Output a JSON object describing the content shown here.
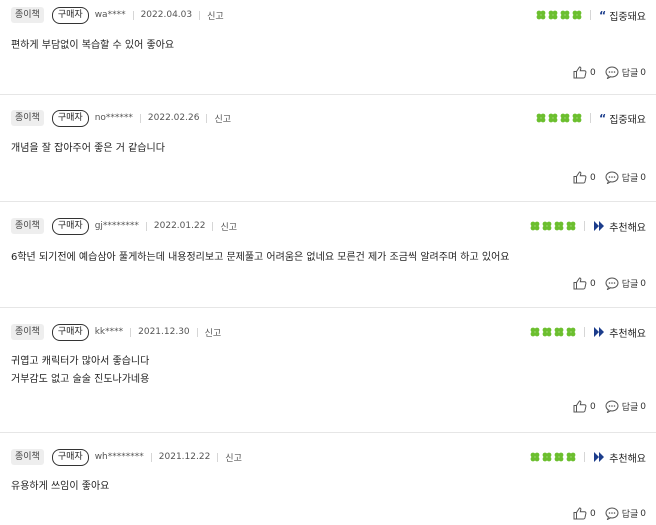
{
  "colors": {
    "star": "#6cbf2f",
    "accent": "#1c3d8c"
  },
  "reviews": [
    {
      "type": "종이책",
      "buyer": "구매자",
      "user": "wa****",
      "date": "2022.04.03",
      "report": "신고",
      "rating_text": "집중돼요",
      "rating_icon": "quote-icon",
      "stars": 4,
      "lines": [
        "편하게 부담없이 복습할 수 있어 좋아요"
      ],
      "likes": "0",
      "reply_label": "답글",
      "replies": "0"
    },
    {
      "type": "종이책",
      "buyer": "구매자",
      "user": "no******",
      "date": "2022.02.26",
      "report": "신고",
      "rating_text": "집중돼요",
      "rating_icon": "quote-icon",
      "stars": 4,
      "lines": [
        "개념을 잘 잡아주어 좋은 거 같습니다"
      ],
      "likes": "0",
      "reply_label": "답글",
      "replies": "0"
    },
    {
      "type": "종이책",
      "buyer": "구매자",
      "user": "gj********",
      "date": "2022.01.22",
      "report": "신고",
      "rating_text": "추천해요",
      "rating_icon": "thumb-icon",
      "stars": 4,
      "lines": [
        "6학년 되기전에 예습삼아 풀게하는데 내용정리보고 문제풀고 어려움은 없네요 모른건 제가 조금씩 알려주며 하고 있어요"
      ],
      "likes": "0",
      "reply_label": "답글",
      "replies": "0"
    },
    {
      "type": "종이책",
      "buyer": "구매자",
      "user": "kk****",
      "date": "2021.12.30",
      "report": "신고",
      "rating_text": "추천해요",
      "rating_icon": "thumb-icon",
      "stars": 4,
      "lines": [
        "귀엽고 캐릭터가 많아서 좋습니다",
        "거부감도 없고 술술 진도나가네용"
      ],
      "likes": "0",
      "reply_label": "답글",
      "replies": "0"
    },
    {
      "type": "종이책",
      "buyer": "구매자",
      "user": "wh********",
      "date": "2021.12.22",
      "report": "신고",
      "rating_text": "추천해요",
      "rating_icon": "thumb-icon",
      "stars": 4,
      "lines": [
        "유용하게 쓰임이 좋아요"
      ],
      "likes": "0",
      "reply_label": "답글",
      "replies": "0"
    }
  ]
}
